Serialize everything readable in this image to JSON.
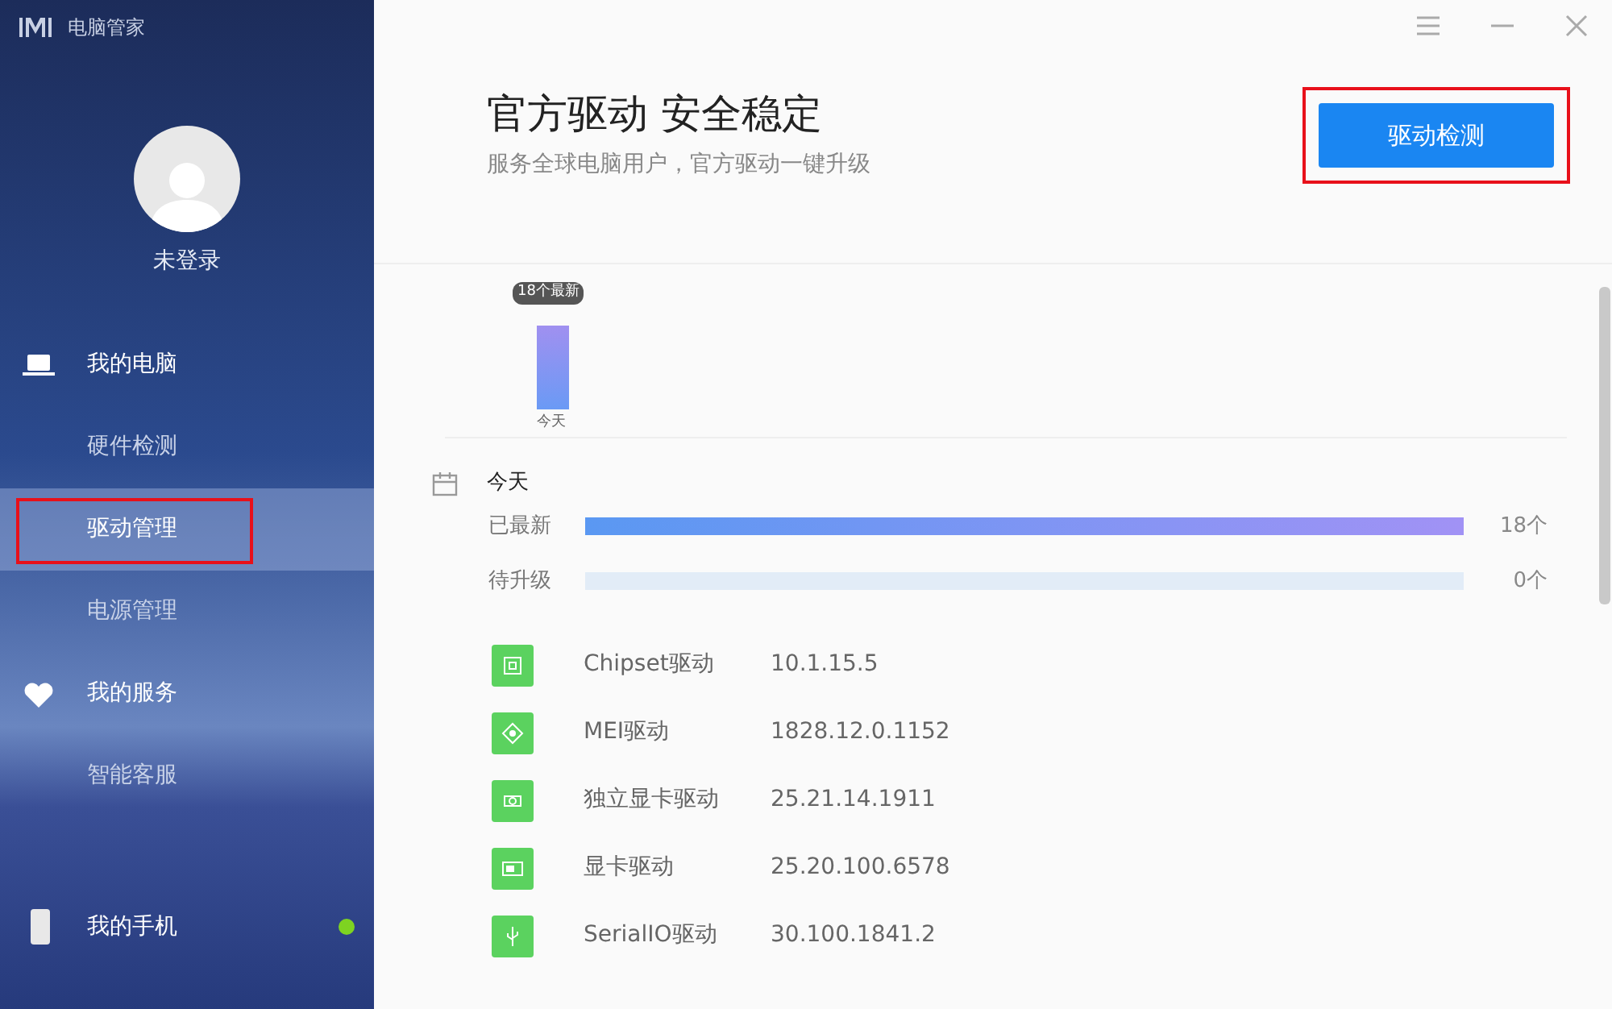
{
  "app": {
    "title": "电脑管家"
  },
  "user": {
    "name": "未登录"
  },
  "sidebar": {
    "items": [
      {
        "kind": "section",
        "label": "我的电脑",
        "selected": false,
        "annotated": false
      },
      {
        "kind": "item",
        "label": "硬件检测",
        "selected": false,
        "annotated": false
      },
      {
        "kind": "item",
        "label": "驱动管理",
        "selected": true,
        "annotated": true
      },
      {
        "kind": "item",
        "label": "电源管理",
        "selected": false,
        "annotated": false
      },
      {
        "kind": "section",
        "label": "我的服务",
        "selected": false,
        "annotated": false
      },
      {
        "kind": "item",
        "label": "智能客服",
        "selected": false,
        "annotated": false
      }
    ],
    "phone": {
      "label": "我的手机",
      "color": "#7ed321"
    }
  },
  "header": {
    "title": "官方驱动 安全稳定",
    "subtitle": "服务全球电脑用户，官方驱动一键升级",
    "button": {
      "label": "驱动检测",
      "annotated": true
    }
  },
  "history": {
    "tooltip": "18个最新",
    "category": "今天"
  },
  "summary": {
    "date": "今天",
    "bars": [
      {
        "label": "已最新",
        "level": 1.0,
        "count": "18个",
        "kind": "done"
      },
      {
        "label": "待升级",
        "level": 0,
        "count": "0个",
        "kind": "pending"
      }
    ]
  },
  "drivers": [
    {
      "name": "Chipset驱动",
      "version": "10.1.15.5"
    },
    {
      "name": "MEI驱动",
      "version": "1828.12.0.1152"
    },
    {
      "name": "独立显卡驱动",
      "version": "25.21.14.1911"
    },
    {
      "name": "显卡驱动",
      "version": "25.20.100.6578"
    },
    {
      "name": "SerialIO驱动",
      "version": "30.100.1841.2"
    }
  ]
}
